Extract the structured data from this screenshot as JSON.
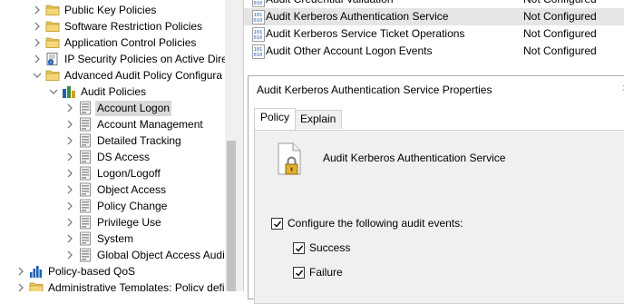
{
  "tree": {
    "items": [
      {
        "label": "Public Key Policies",
        "icon": "folder-icon",
        "expander": "collapsed"
      },
      {
        "label": "Software Restriction Policies",
        "icon": "folder-icon",
        "expander": "collapsed"
      },
      {
        "label": "Application Control Policies",
        "icon": "folder-icon",
        "expander": "collapsed"
      },
      {
        "label": "IP Security Policies on Active Dire",
        "icon": "ip-security-icon",
        "expander": "collapsed"
      },
      {
        "label": "Advanced Audit Policy Configura",
        "icon": "folder-icon",
        "expander": "expanded"
      },
      {
        "label": "Audit Policies",
        "icon": "audit-policies-icon",
        "expander": "expanded"
      },
      {
        "label": "Account Logon",
        "icon": "policy-category-icon",
        "expander": "collapsed"
      },
      {
        "label": "Account Management",
        "icon": "policy-category-icon",
        "expander": "collapsed"
      },
      {
        "label": "Detailed Tracking",
        "icon": "policy-category-icon",
        "expander": "collapsed"
      },
      {
        "label": "DS Access",
        "icon": "policy-category-icon",
        "expander": "collapsed"
      },
      {
        "label": "Logon/Logoff",
        "icon": "policy-category-icon",
        "expander": "collapsed"
      },
      {
        "label": "Object Access",
        "icon": "policy-category-icon",
        "expander": "collapsed"
      },
      {
        "label": "Policy Change",
        "icon": "policy-category-icon",
        "expander": "collapsed"
      },
      {
        "label": "Privilege Use",
        "icon": "policy-category-icon",
        "expander": "collapsed"
      },
      {
        "label": "System",
        "icon": "policy-category-icon",
        "expander": "collapsed"
      },
      {
        "label": "Global Object Access Audi",
        "icon": "policy-category-icon",
        "expander": "collapsed"
      },
      {
        "label": "Policy-based QoS",
        "icon": "bar-chart-icon",
        "expander": "collapsed"
      },
      {
        "label": "Administrative Templates: Policy definiti",
        "icon": "folder-icon",
        "expander": "collapsed"
      }
    ],
    "selected_label": "Account Logon"
  },
  "list": {
    "rows": [
      {
        "name": "Audit Credential Validation",
        "status": "Not Configured",
        "icon": "binary-policy-icon"
      },
      {
        "name": "Audit Kerberos Authentication Service",
        "status": "Not Configured",
        "icon": "binary-policy-icon"
      },
      {
        "name": "Audit Kerberos Service Ticket Operations",
        "status": "Not Configured",
        "icon": "binary-policy-icon"
      },
      {
        "name": "Audit Other Account Logon Events",
        "status": "Not Configured",
        "icon": "binary-policy-icon"
      }
    ]
  },
  "dialog": {
    "title": "Audit Kerberos Authentication Service Properties",
    "close_glyph": "×",
    "tabs": [
      "Policy",
      "Explain"
    ],
    "active_tab": "Policy",
    "policy_name": "Audit Kerberos Authentication Service",
    "configure_label": "Configure the following audit events:",
    "configure_checked": true,
    "success_label": "Success",
    "success_checked": true,
    "failure_label": "Failure",
    "failure_checked": true
  }
}
